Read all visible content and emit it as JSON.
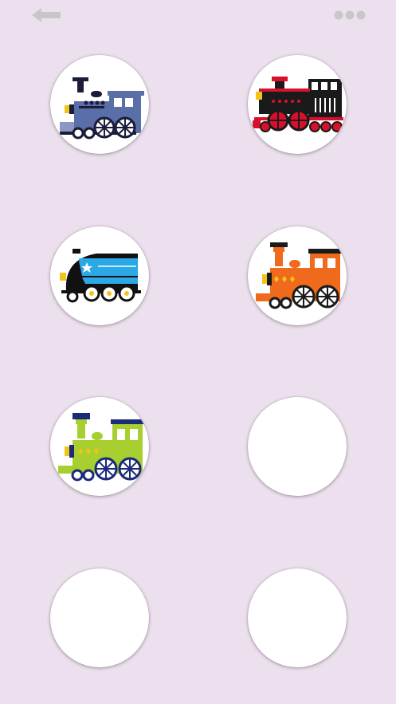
{
  "toolbar": {
    "back_icon": "arrow-left-icon",
    "more_icon": "more-dots-icon",
    "icon_color": "#c7c7c7"
  },
  "slots": [
    {
      "content": "blue-steam-locomotive-icon",
      "filled": true,
      "colors": {
        "body": "#5a6fa8",
        "accent": "#1b1b3a"
      }
    },
    {
      "content": "black-red-steam-locomotive-icon",
      "filled": true,
      "colors": {
        "body": "#1a1a1a",
        "accent": "#d8102c"
      }
    },
    {
      "content": "blue-streamliner-locomotive-icon",
      "filled": true,
      "colors": {
        "body": "#2aa9e6",
        "accent": "#111111"
      }
    },
    {
      "content": "orange-steam-locomotive-icon",
      "filled": true,
      "colors": {
        "body": "#ef6a1c",
        "accent": "#1a1a1a"
      }
    },
    {
      "content": "green-steam-locomotive-icon",
      "filled": true,
      "colors": {
        "body": "#a6cf2f",
        "accent": "#1b2a7a"
      }
    },
    {
      "content": "empty-slot",
      "filled": false
    },
    {
      "content": "empty-slot",
      "filled": false
    },
    {
      "content": "empty-slot",
      "filled": false
    }
  ],
  "background_color": "#ede0ee"
}
